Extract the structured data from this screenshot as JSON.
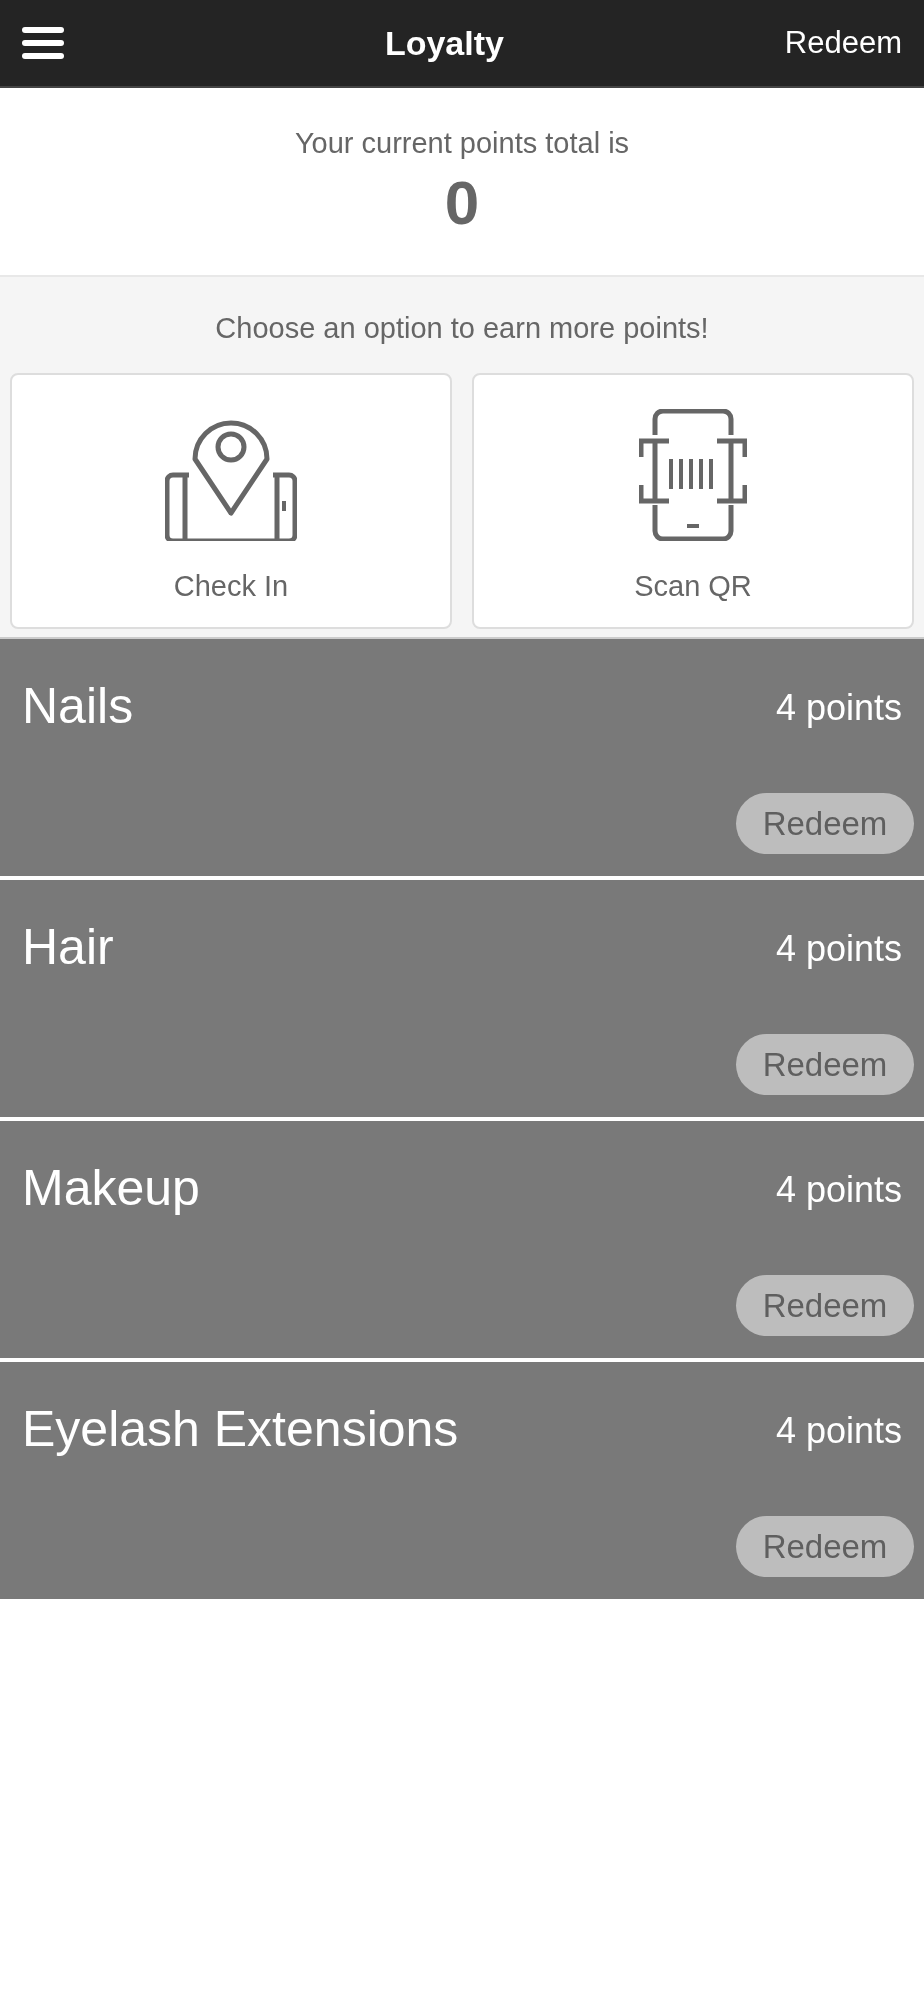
{
  "header": {
    "title": "Loyalty",
    "action": "Redeem"
  },
  "points": {
    "label": "Your current points total is",
    "total": "0"
  },
  "earn": {
    "prompt": "Choose an option to earn more points!",
    "options": [
      {
        "kind": "check-in",
        "label": "Check In"
      },
      {
        "kind": "scan",
        "label": "Scan QR"
      }
    ]
  },
  "rewards": [
    {
      "name": "Nails",
      "points": "4 points",
      "button": "Redeem"
    },
    {
      "name": "Hair",
      "points": "4 points",
      "button": "Redeem"
    },
    {
      "name": "Makeup",
      "points": "4 points",
      "button": "Redeem"
    },
    {
      "name": "Eyelash Extensions",
      "points": "4 points",
      "button": "Redeem"
    }
  ]
}
